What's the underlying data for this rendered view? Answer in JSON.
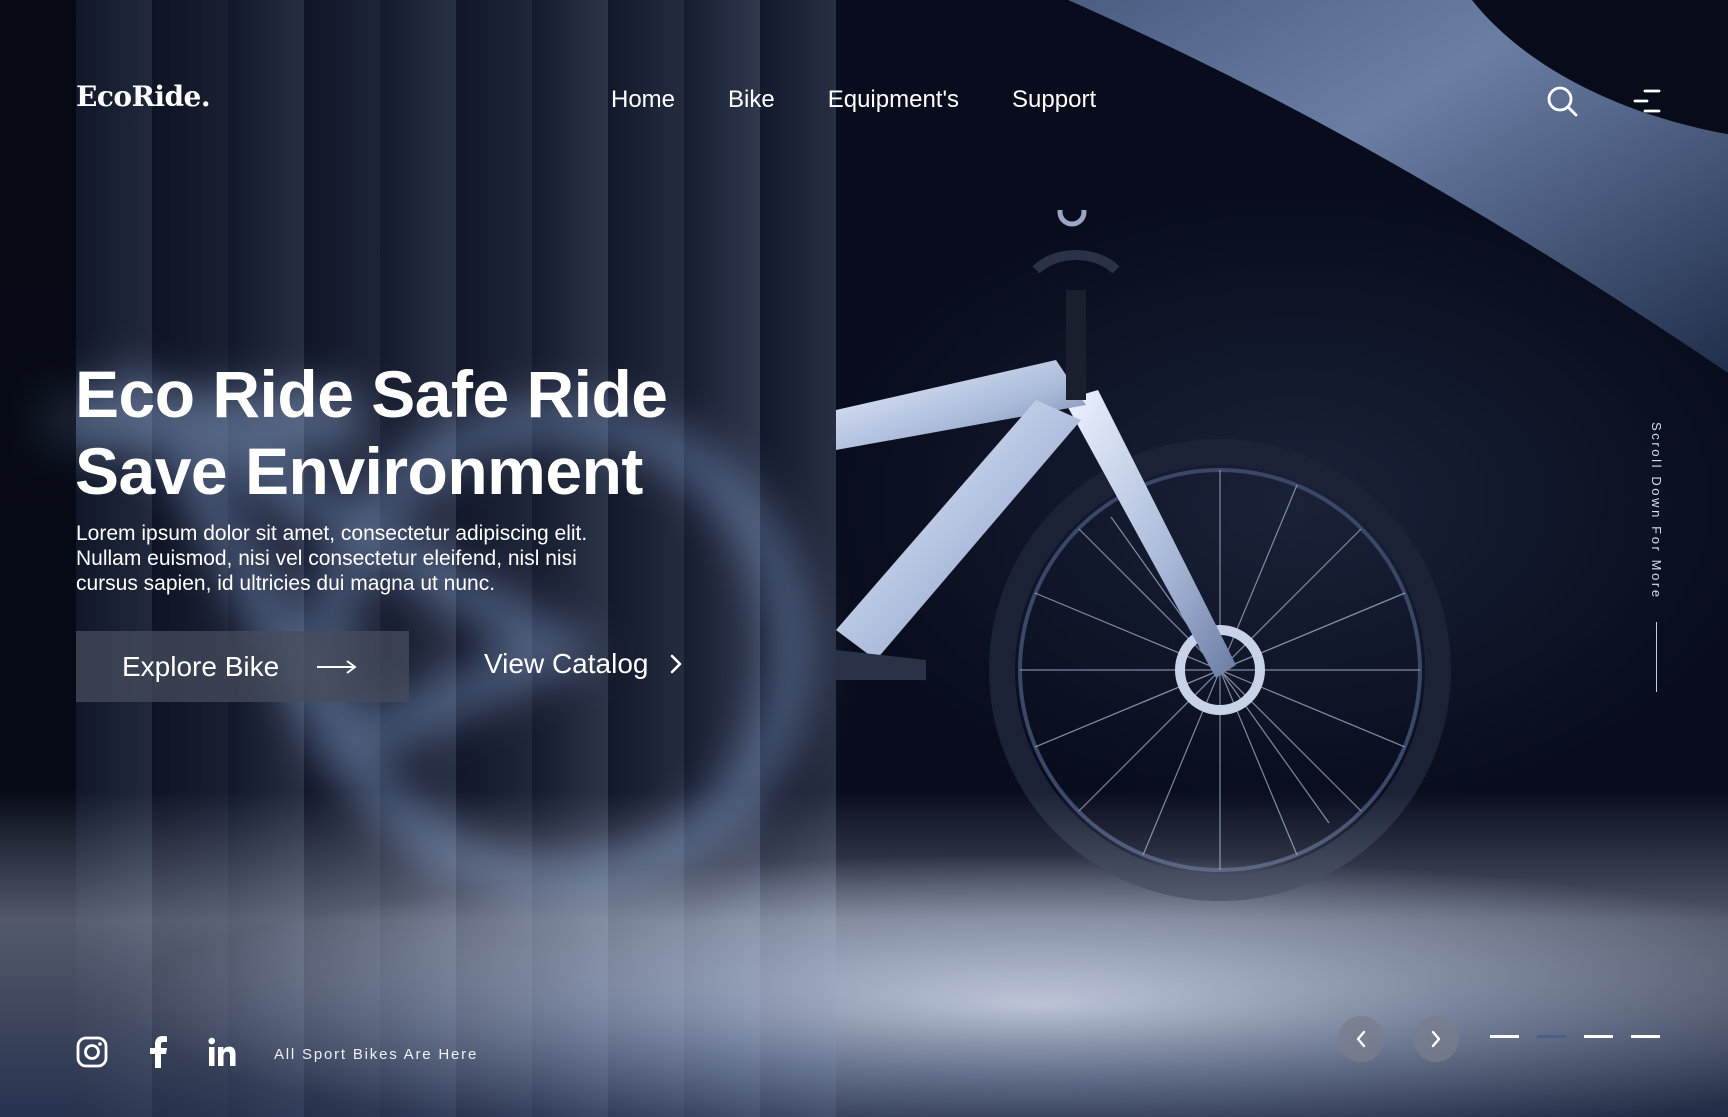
{
  "brand": {
    "logo": "EcoRide."
  },
  "nav": {
    "items": [
      "Home",
      "Bike",
      "Equipment's",
      "Support"
    ]
  },
  "header": {
    "search_icon": "search-icon",
    "menu_icon": "menu-icon"
  },
  "hero": {
    "title_line1": "Eco Ride Safe Ride",
    "title_line2": "Save Environment",
    "description_line1": "Lorem ipsum dolor sit amet, consectetur adipiscing elit.",
    "description_line2": "Nullam euismod, nisi vel consectetur eleifend, nisl nisi",
    "description_line3": "cursus sapien, id ultricies dui magna ut nunc.",
    "primary_button": "Explore Bike",
    "secondary_button": "View Catalog"
  },
  "scroll_hint": "Scroll Down For More",
  "footer": {
    "socials": [
      "instagram-icon",
      "facebook-icon",
      "linkedin-icon"
    ],
    "tagline": "All Sport Bikes Are Here"
  },
  "slider": {
    "total": 4,
    "active_index": 1
  },
  "colors": {
    "background": "#070b1a",
    "accent": "#4a5f8c",
    "button_bg": "#464c5c"
  }
}
